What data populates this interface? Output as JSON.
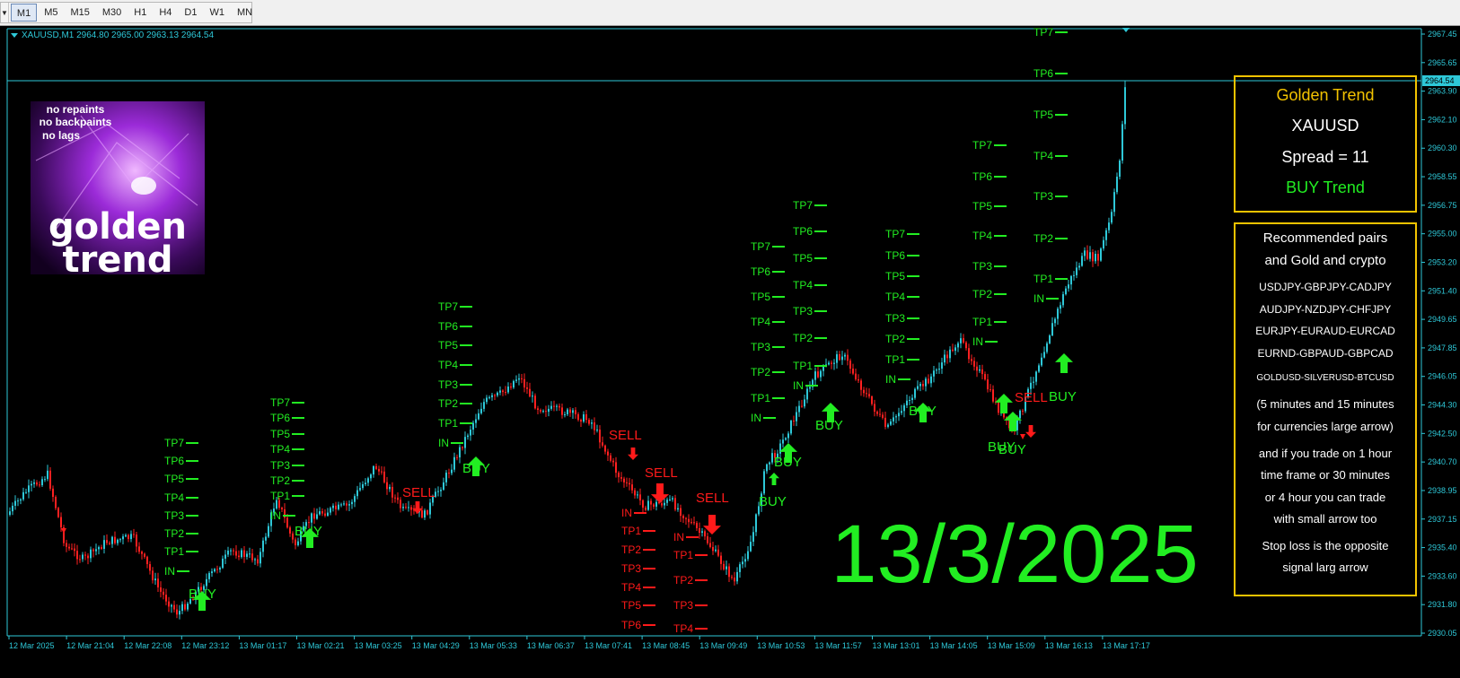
{
  "toolbar": {
    "timeframes": [
      "M1",
      "M5",
      "M15",
      "M30",
      "H1",
      "H4",
      "D1",
      "W1",
      "MN"
    ],
    "active_timeframe": "M1"
  },
  "chart": {
    "symbol_info": "XAUUSD,M1  2964.80 2965.00 2963.13 2964.54",
    "current_price": "2964.54",
    "price_axis": [
      "2967.45",
      "2965.65",
      "2963.90",
      "2962.10",
      "2960.30",
      "2958.55",
      "2956.75",
      "2955.00",
      "2953.20",
      "2951.40",
      "2949.65",
      "2947.85",
      "2946.05",
      "2944.30",
      "2942.50",
      "2940.70",
      "2938.95",
      "2937.15",
      "2935.40",
      "2933.60",
      "2931.80",
      "2930.05"
    ],
    "time_axis": [
      "12 Mar 2025",
      "12 Mar 21:04",
      "12 Mar 22:08",
      "12 Mar 23:12",
      "13 Mar 01:17",
      "13 Mar 02:21",
      "13 Mar 03:25",
      "13 Mar 04:29",
      "13 Mar 05:33",
      "13 Mar 06:37",
      "13 Mar 07:41",
      "13 Mar 08:45",
      "13 Mar 09:49",
      "13 Mar 10:53",
      "13 Mar 11:57",
      "13 Mar 13:01",
      "13 Mar 14:05",
      "13 Mar 15:09",
      "13 Mar 16:13",
      "13 Mar 17:17"
    ],
    "big_date": "13/3/2025",
    "colors": {
      "bull": "#2ec8d8",
      "bear": "#ff2020",
      "buy": "#22ee22",
      "sell": "#ff1a1a",
      "axis": "#2ec8d8",
      "panel_border": "#f3c300"
    }
  },
  "logo": {
    "line1": "no repaints",
    "line2": "no backpaints",
    "line3": "no lags",
    "word1": "golden",
    "word2": "trend"
  },
  "signals": [
    {
      "label": "BUY",
      "type": "buy"
    },
    {
      "label": "BUY",
      "type": "buy"
    },
    {
      "label": "SELL",
      "type": "sell"
    },
    {
      "label": "BUY",
      "type": "buy"
    },
    {
      "label": "SELL",
      "type": "sell"
    },
    {
      "label": "SELL",
      "type": "sell"
    },
    {
      "label": "SELL",
      "type": "sell"
    },
    {
      "label": "BUY",
      "type": "buy"
    },
    {
      "label": "BUY",
      "type": "buy"
    },
    {
      "label": "BUY",
      "type": "buy"
    },
    {
      "label": "BUY",
      "type": "buy"
    },
    {
      "label": "BUY",
      "type": "buy"
    },
    {
      "label": "BUY",
      "type": "buy"
    },
    {
      "label": "SELL",
      "type": "sell"
    },
    {
      "label": "BUY",
      "type": "buy"
    }
  ],
  "levels": {
    "entry": "IN",
    "tp": [
      "TP1",
      "TP2",
      "TP3",
      "TP4",
      "TP5",
      "TP6",
      "TP7"
    ]
  },
  "info_panel": {
    "title": "Golden Trend",
    "symbol": "XAUUSD",
    "spread": "Spread = 11",
    "trend": "BUY Trend"
  },
  "recommend_panel": {
    "title_line1": "Recommended pairs",
    "title_line2": "and Gold and crypto",
    "pairs1": "USDJPY-GBPJPY-CADJPY",
    "pairs2": "AUDJPY-NZDJPY-CHFJPY",
    "pairs3": "EURJPY-EURAUD-EURCAD",
    "pairs4": "EURND-GBPAUD-GBPCAD",
    "pairs5": "GOLDUSD-SILVERUSD-BTCUSD",
    "note1": "(5 minutes and 15 minutes",
    "note2": "for currencies large arrow)",
    "note3": "and if you trade on 1 hour",
    "note4": "time frame or 30 minutes",
    "note5": "or 4 hour you can trade",
    "note6": "with small arrow too",
    "note7": "Stop loss is the opposite",
    "note8": "signal larg arrow"
  }
}
